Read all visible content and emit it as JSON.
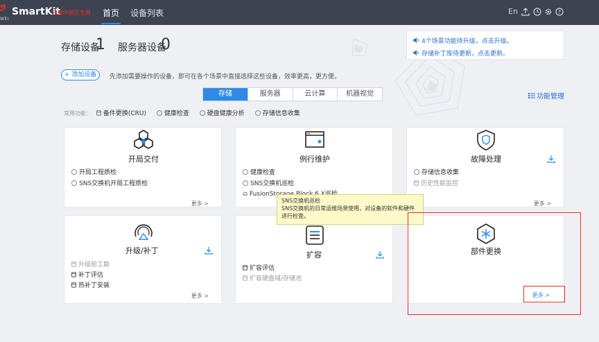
{
  "header": {
    "logo_sub": "WEI",
    "brand": "SmartKit",
    "brand_tag": "-云端中国区专用",
    "nav": [
      {
        "label": "首页",
        "active": true
      },
      {
        "label": "设备列表",
        "active": false
      }
    ],
    "lang": "En",
    "icons": [
      "upload-icon",
      "clock-icon",
      "gear-icon",
      "help-icon"
    ]
  },
  "counts": {
    "storage_label": "存储设备",
    "storage_value": "1",
    "server_label": "服务器设备",
    "server_value": "0"
  },
  "notices": [
    "4个场景功能待升级，点击升级。",
    "存储补丁库待更新，点击更新。"
  ],
  "add_device": {
    "label": "+ 添加设备",
    "hint": "先添加需要操作的设备，即可在各个场景中直接选择这些设备，效率更高，更方便。"
  },
  "tabs": [
    {
      "label": "存储",
      "active": true
    },
    {
      "label": "服务器",
      "active": false
    },
    {
      "label": "云计算",
      "active": false
    },
    {
      "label": "机器视觉",
      "active": false
    }
  ],
  "func_mgr": "功能管理",
  "common": {
    "label": "常用功能：",
    "items": [
      "备件更换(CRU)",
      "健康检查",
      "硬盘健康分析",
      "存储信息收集"
    ]
  },
  "cards": {
    "c1": {
      "title": "开局交付",
      "items": [
        "开局工程质检",
        "SNS交换机开局工程质检"
      ],
      "more": "更多 >"
    },
    "c2": {
      "title": "例行维护",
      "items": [
        "健康检查",
        "SNS交换机巡检",
        "FusionStorage Block 6.X巡检"
      ]
    },
    "c3": {
      "title": "故障处理",
      "items": [
        "存储信息收集",
        "历史性能监控"
      ],
      "more": "更多 >"
    },
    "c4": {
      "title": "升级/补丁",
      "items": [
        "升级前工勘",
        "补丁评估",
        "热补丁安装"
      ],
      "more": "更多 >"
    },
    "c5": {
      "title": "扩容",
      "items": [
        "扩容评估",
        "扩容硬盘域/存储池"
      ]
    },
    "c6": {
      "title": "部件更换",
      "more": "更多 >"
    }
  },
  "tooltip": {
    "title": "SNS交换机巡检",
    "body": "SNS交换机的日常运维场景使用，对设备的软件和硬件进行检查。"
  },
  "colors": {
    "header_bg": "#3d4350",
    "accent": "#2e8ae6",
    "highlight": "#e4322b",
    "brand_red": "#e4322b"
  }
}
